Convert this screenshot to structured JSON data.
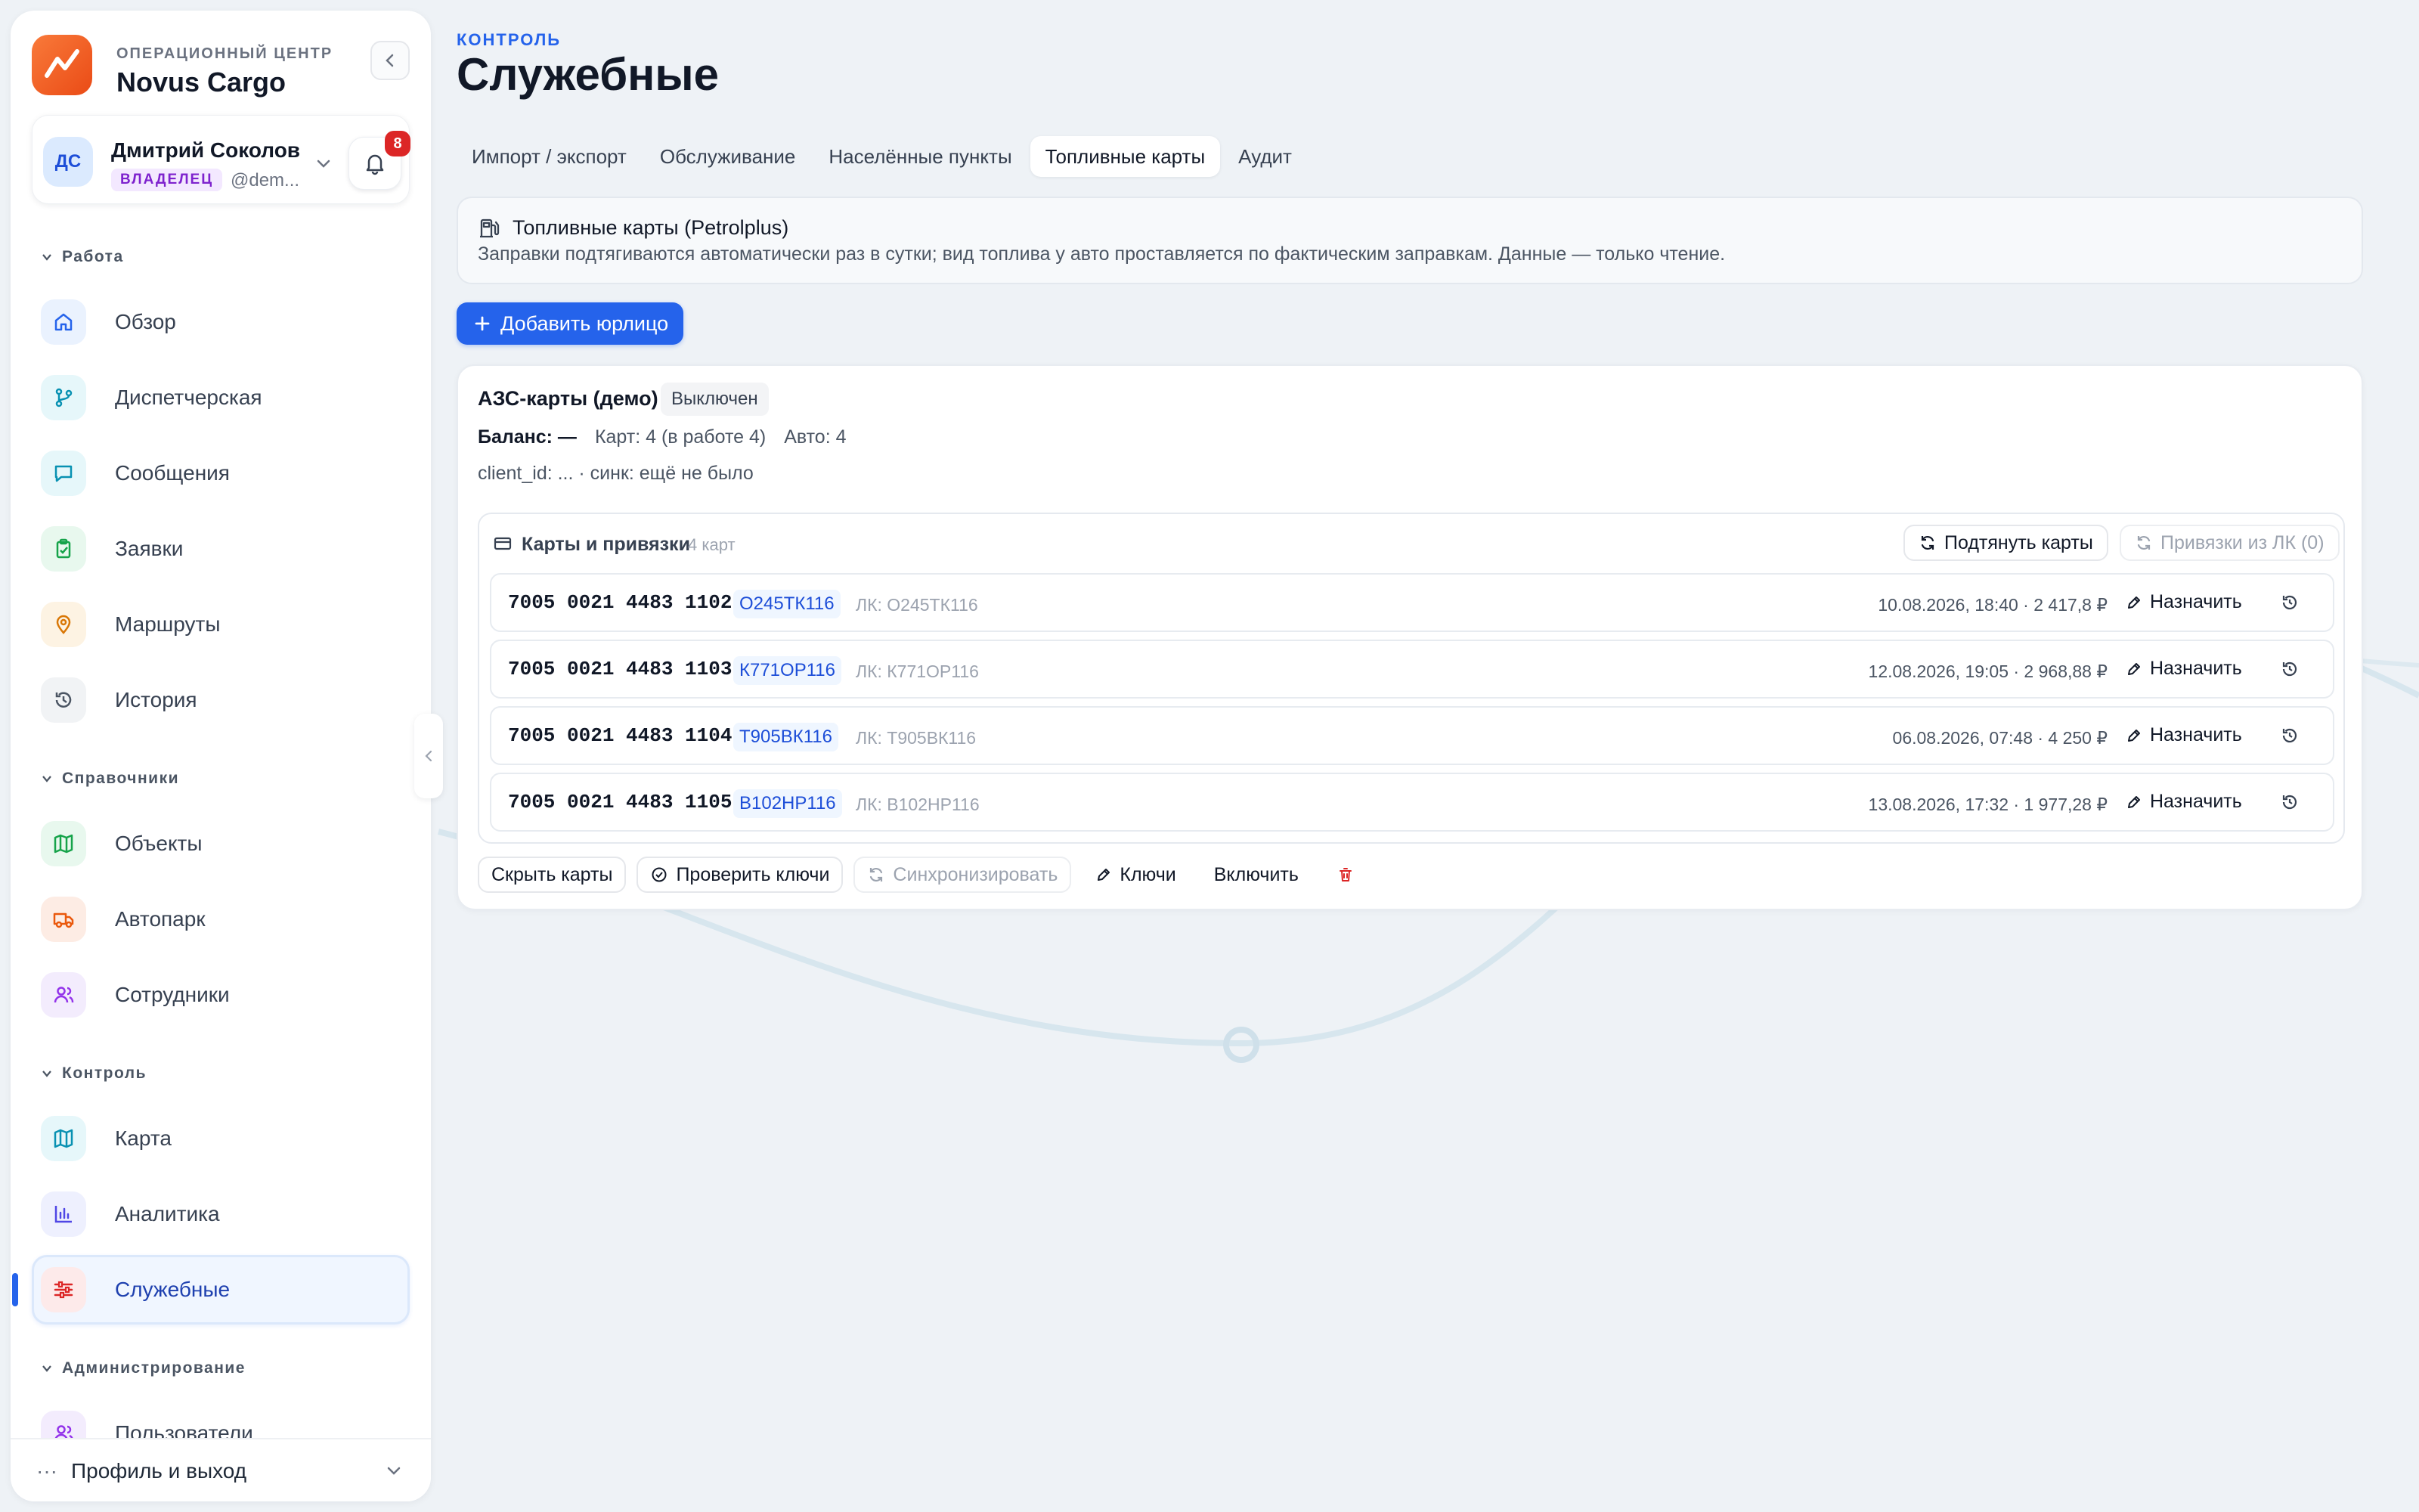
{
  "brand": {
    "subtitle": "ОПЕРАЦИОННЫЙ ЦЕНТР",
    "title": "Novus Cargo"
  },
  "user": {
    "initials": "ДС",
    "name": "Дмитрий Соколов",
    "role": "ВЛАДЕЛЕЦ",
    "handle": "@dem...",
    "notifications": "8"
  },
  "sidebar": {
    "sections": [
      {
        "title": "Работа",
        "items": [
          "Обзор",
          "Диспетчерская",
          "Сообщения",
          "Заявки",
          "Маршруты",
          "История"
        ]
      },
      {
        "title": "Справочники",
        "items": [
          "Объекты",
          "Автопарк",
          "Сотрудники"
        ]
      },
      {
        "title": "Контроль",
        "items": [
          "Карта",
          "Аналитика",
          "Служебные"
        ]
      },
      {
        "title": "Администрирование",
        "items": [
          "Пользователи"
        ]
      }
    ],
    "footer_label": "Профиль и выход"
  },
  "page": {
    "breadcrumb": "КОНТРОЛЬ",
    "title": "Служебные"
  },
  "tabs": [
    "Импорт / экспорт",
    "Обслуживание",
    "Населённые пункты",
    "Топливные карты",
    "Аудит"
  ],
  "active_tab": "Топливные карты",
  "info": {
    "title": "Топливные карты (Petrolplus)",
    "description": "Заправки подтягиваются автоматически раз в сутки; вид топлива у авто проставляется по фактическим заправкам. Данные — только чтение."
  },
  "add_button": "Добавить юрлицо",
  "card": {
    "title": "АЗС-карты (демо)",
    "status": "Выключен",
    "balance_label": "Баланс: —",
    "cards_label": "Карт: 4 (в работе 4)",
    "autos_label": "Авто: 4",
    "client_line": "client_id: ... · синк: ещё не было",
    "section_title": "Карты и привязки",
    "section_count": "4 карт",
    "pull_button": "Подтянуть карты",
    "lk_button": "Привязки из ЛК (0)",
    "rows": [
      {
        "number": "7005 0021 4483 1102",
        "plate": "О245ТК116",
        "lk": "ЛК: О245ТК116",
        "when": "10.08.2026, 18:40 · 2 417,8 ₽",
        "action": "Назначить"
      },
      {
        "number": "7005 0021 4483 1103",
        "plate": "К771ОР116",
        "lk": "ЛК: К771ОР116",
        "when": "12.08.2026, 19:05 · 2 968,88 ₽",
        "action": "Назначить"
      },
      {
        "number": "7005 0021 4483 1104",
        "plate": "Т905ВК116",
        "lk": "ЛК: Т905ВК116",
        "when": "06.08.2026, 07:48 · 4 250 ₽",
        "action": "Назначить"
      },
      {
        "number": "7005 0021 4483 1105",
        "plate": "В102НР116",
        "lk": "ЛК: В102НР116",
        "when": "13.08.2026, 17:32 · 1 977,28 ₽",
        "action": "Назначить"
      }
    ],
    "actions": {
      "hide": "Скрыть карты",
      "check": "Проверить ключи",
      "sync": "Синхронизировать",
      "keys": "Ключи",
      "enable": "Включить"
    }
  },
  "colors": {
    "accent": "#2563eb",
    "brand_orange": "#ea4b16",
    "danger": "#dc2626"
  }
}
